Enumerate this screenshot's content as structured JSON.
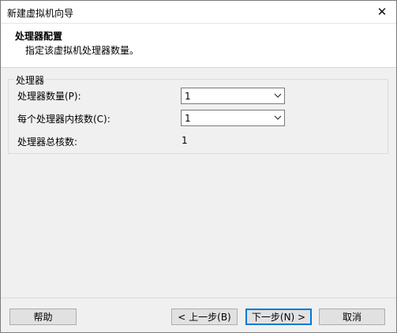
{
  "window": {
    "title": "新建虚拟机向导"
  },
  "header": {
    "title": "处理器配置",
    "subtitle": "指定该虚拟机处理器数量。"
  },
  "processor_group": {
    "legend": "处理器",
    "count_label": "处理器数量(P):",
    "count_value": "1",
    "cores_label": "每个处理器内核数(C):",
    "cores_value": "1",
    "total_label": "处理器总核数:",
    "total_value": "1"
  },
  "footer": {
    "help_label": "帮助",
    "back_label": "< 上一步(B)",
    "next_label": "下一步(N) >",
    "cancel_label": "取消"
  },
  "colors": {
    "accent": "#0078d7",
    "window_bg": "#f0f0f0"
  }
}
